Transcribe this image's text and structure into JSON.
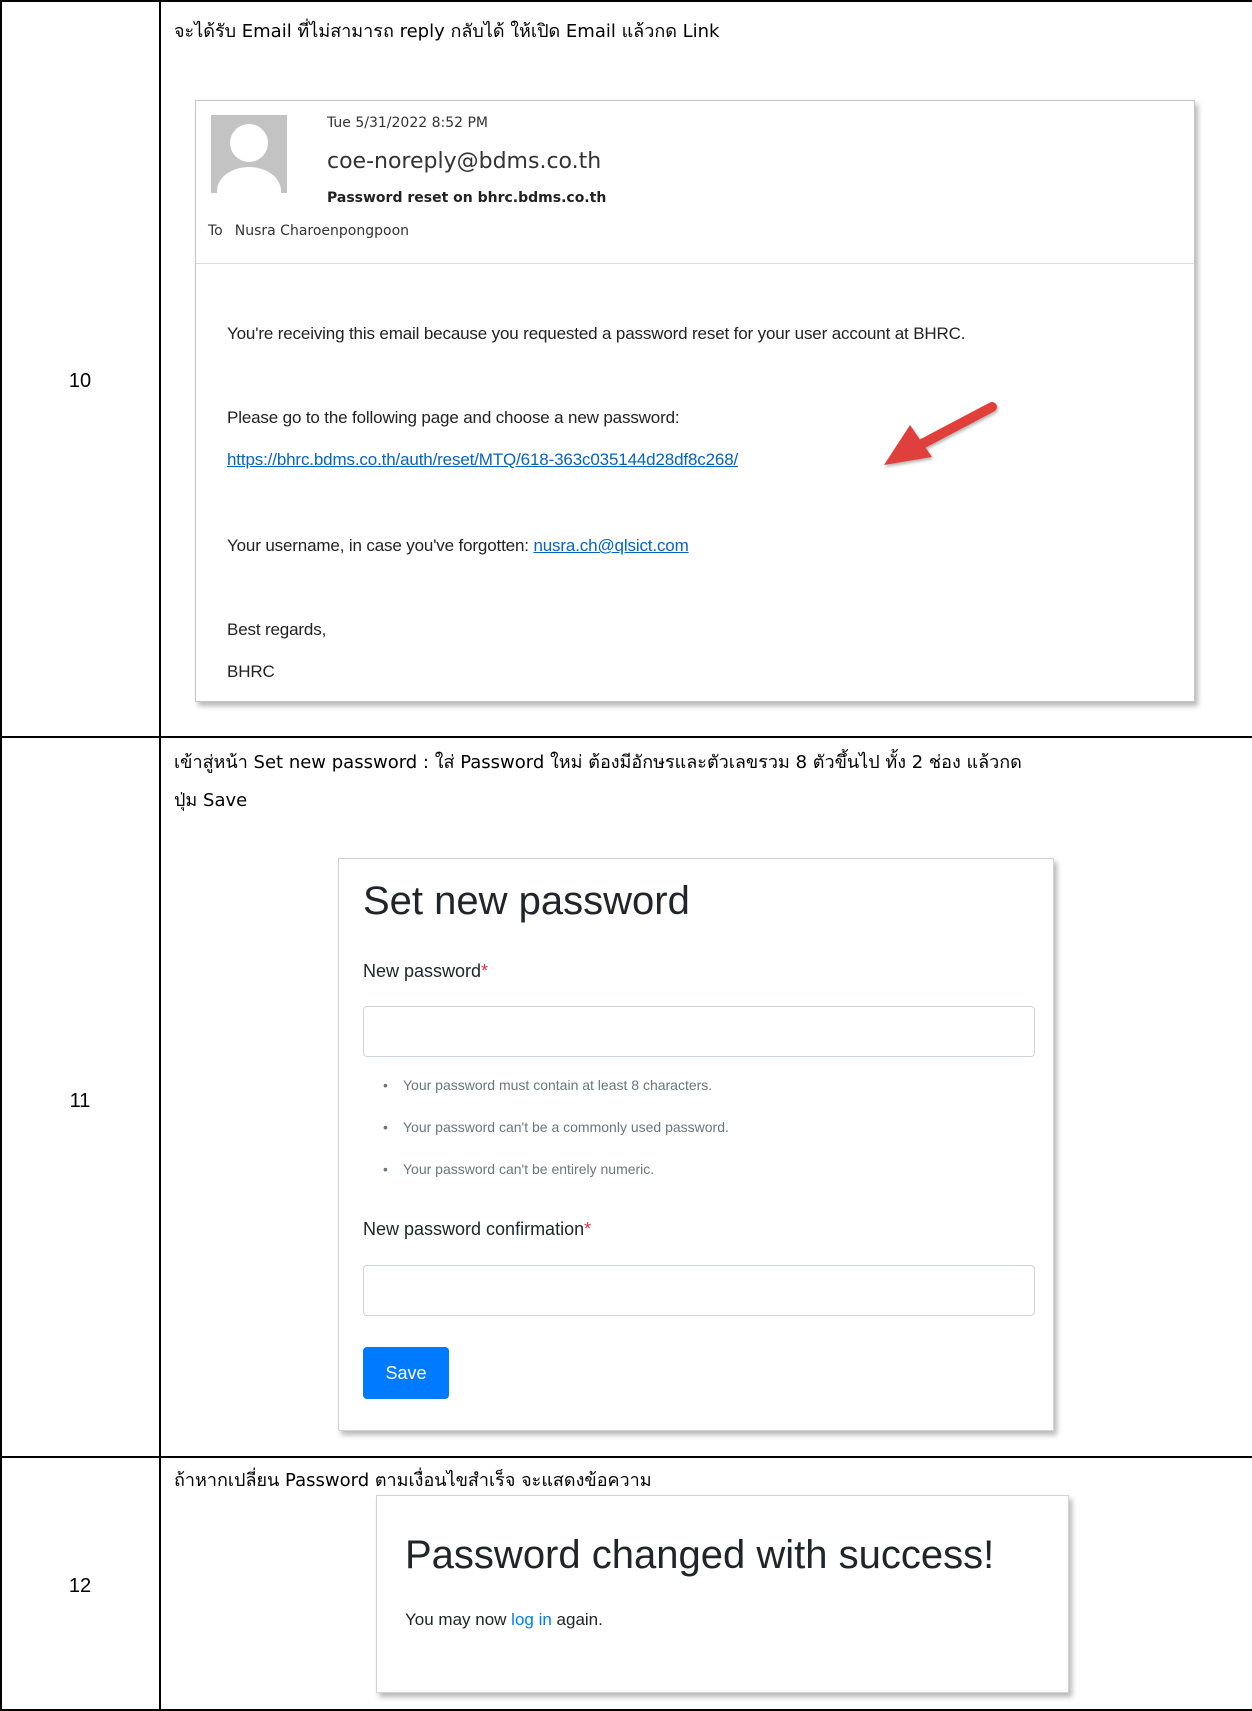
{
  "rows": [
    {
      "step": "10",
      "instruction": "จะได้รับ Email ที่ไม่สามารถ reply กลับได้ ให้เปิด Email แล้วกด Link"
    },
    {
      "step": "11",
      "instruction_line1": "เข้าสู่หน้า Set new password : ใส่ Password ใหม่ ต้องมีอักษรและตัวเลขรวม 8 ตัวขึ้นไป ทั้ง 2 ช่อง แล้วกด",
      "instruction_line2": "ปุ่ม Save"
    },
    {
      "step": "12",
      "instruction": "ถ้าหากเปลี่ยน Password ตามเงื่อนไขสำเร็จ จะแสดงข้อความ"
    }
  ],
  "email": {
    "date": "Tue 5/31/2022 8:52 PM",
    "from": "coe-noreply@bdms.co.th",
    "subject": "Password reset on bhrc.bdms.co.th",
    "to_label": "To",
    "to_name": "Nusra Charoenpongpoon",
    "body_intro": "You're receiving this email because you requested a password reset for your user account at BHRC.",
    "body_instruction": "Please go to the following page and choose a new password:",
    "reset_link": "https://bhrc.bdms.co.th/auth/reset/MTQ/618-363c035144d28df8c268/",
    "username_text": "Your username, in case you've forgotten: ",
    "username_link": "nusra.ch@qlsict.com",
    "regards": "Best regards,",
    "signature": "BHRC"
  },
  "set_password": {
    "title": "Set new password",
    "new_password_label": "New password",
    "required_mark": "*",
    "help": [
      "Your password must contain at least 8 characters.",
      "Your password can't be a commonly used password.",
      "Your password can't be entirely numeric."
    ],
    "confirm_label": "New password confirmation",
    "save_label": "Save"
  },
  "success": {
    "title": "Password changed with success!",
    "msg_before": "You may now ",
    "link": "log in",
    "msg_after": " again."
  },
  "colors": {
    "link": "#0563c1",
    "primary": "#007bff",
    "required": "#dc3545",
    "arrow": "#e0403a"
  }
}
